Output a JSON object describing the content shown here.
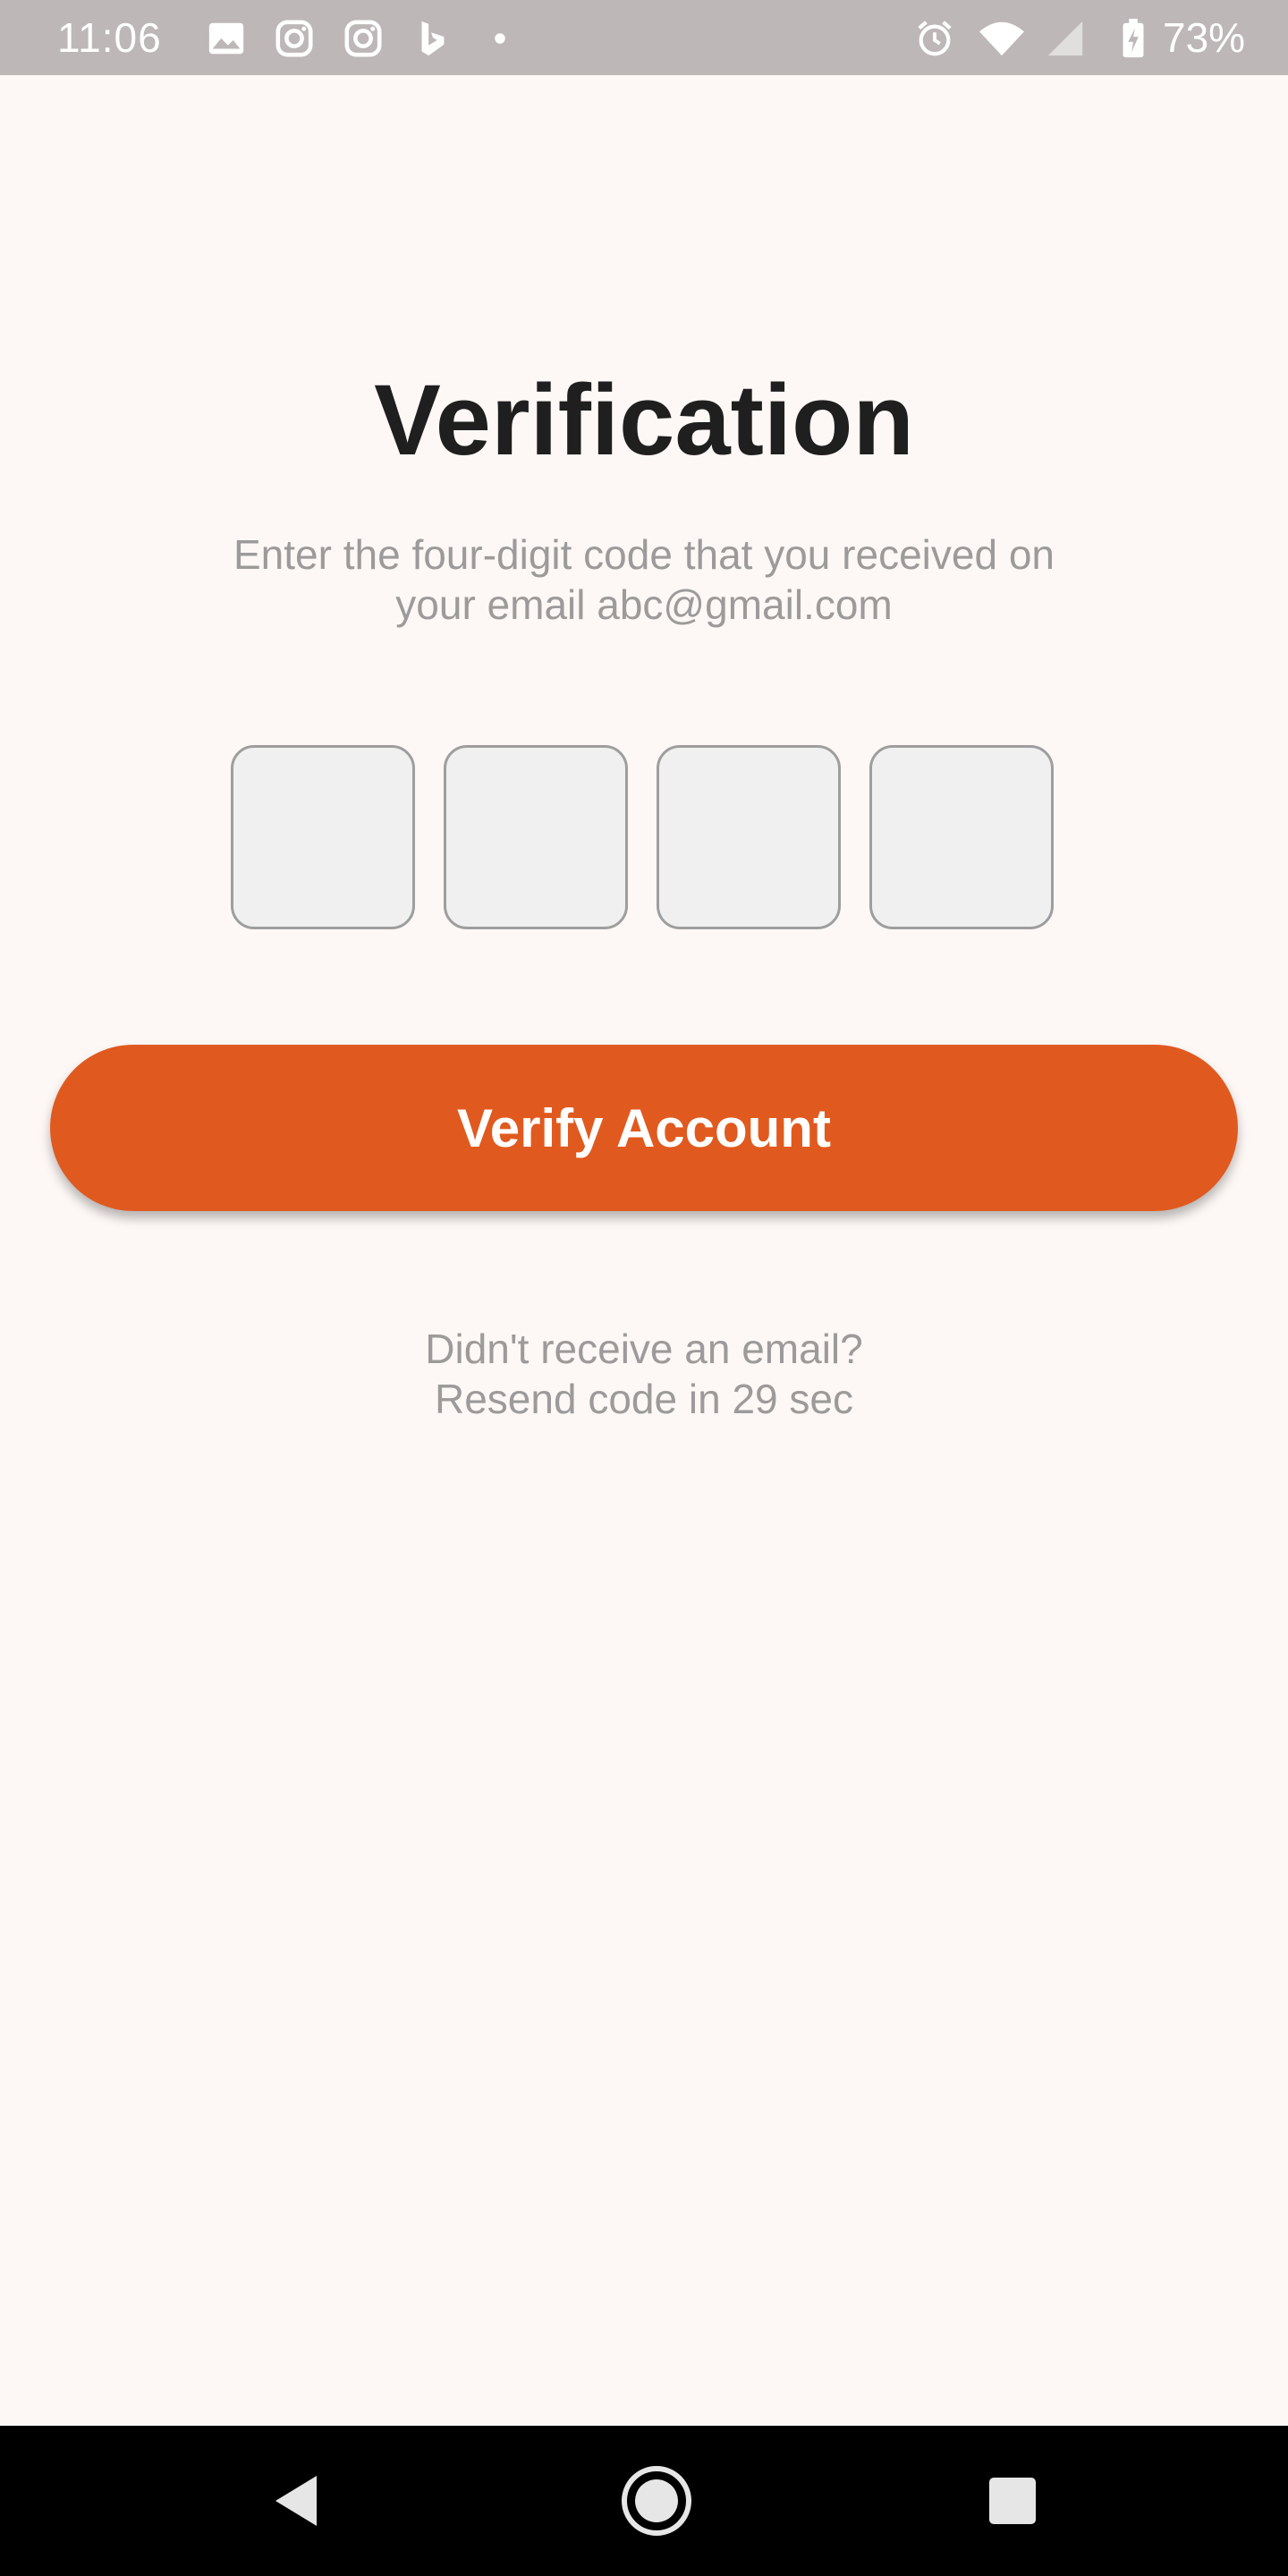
{
  "status_bar": {
    "time": "11:06",
    "battery": "73%",
    "notification_icons": [
      "image-icon",
      "instagram-icon",
      "instagram-icon",
      "bing-icon",
      "dot-icon"
    ],
    "system_icons": [
      "alarm-icon",
      "wifi-icon",
      "signal-icon",
      "battery-charging-icon"
    ]
  },
  "verification": {
    "title": "Verification",
    "subtitle_line1": "Enter the four-digit code that you received on",
    "subtitle_line2": "your email abc@gmail.com",
    "code_digits": [
      "",
      "",
      "",
      ""
    ],
    "verify_button_label": "Verify Account",
    "resend_line1": "Didn't receive an email?",
    "resend_line2": "Resend code in 29 sec"
  },
  "colors": {
    "accent": "#e05a1f",
    "background": "#fdf8f6",
    "status_bar": "#bdb7b7",
    "code_box_fill": "#f0f0f0",
    "muted_text": "#9c9a9a"
  },
  "nav_bar": {
    "buttons": [
      "back-icon",
      "home-icon",
      "recents-icon"
    ]
  }
}
